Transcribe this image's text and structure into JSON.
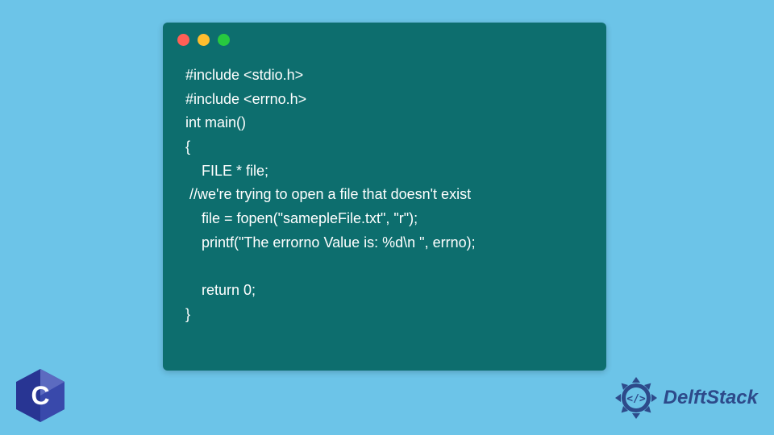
{
  "code": {
    "lines": [
      "#include <stdio.h>",
      "#include <errno.h>",
      "int main()",
      "{",
      "    FILE * file;",
      " //we're trying to open a file that doesn't exist",
      "    file = fopen(\"samepleFile.txt\", \"r\");",
      "    printf(\"The errorno Value is: %d\\n \", errno);",
      "",
      "    return 0;",
      "}"
    ]
  },
  "branding": {
    "delft_text": "DelftStack",
    "c_label": "C"
  },
  "colors": {
    "bg": "#6cc4e8",
    "window": "#0d6e6e",
    "delft_blue": "#2d4a8a"
  }
}
